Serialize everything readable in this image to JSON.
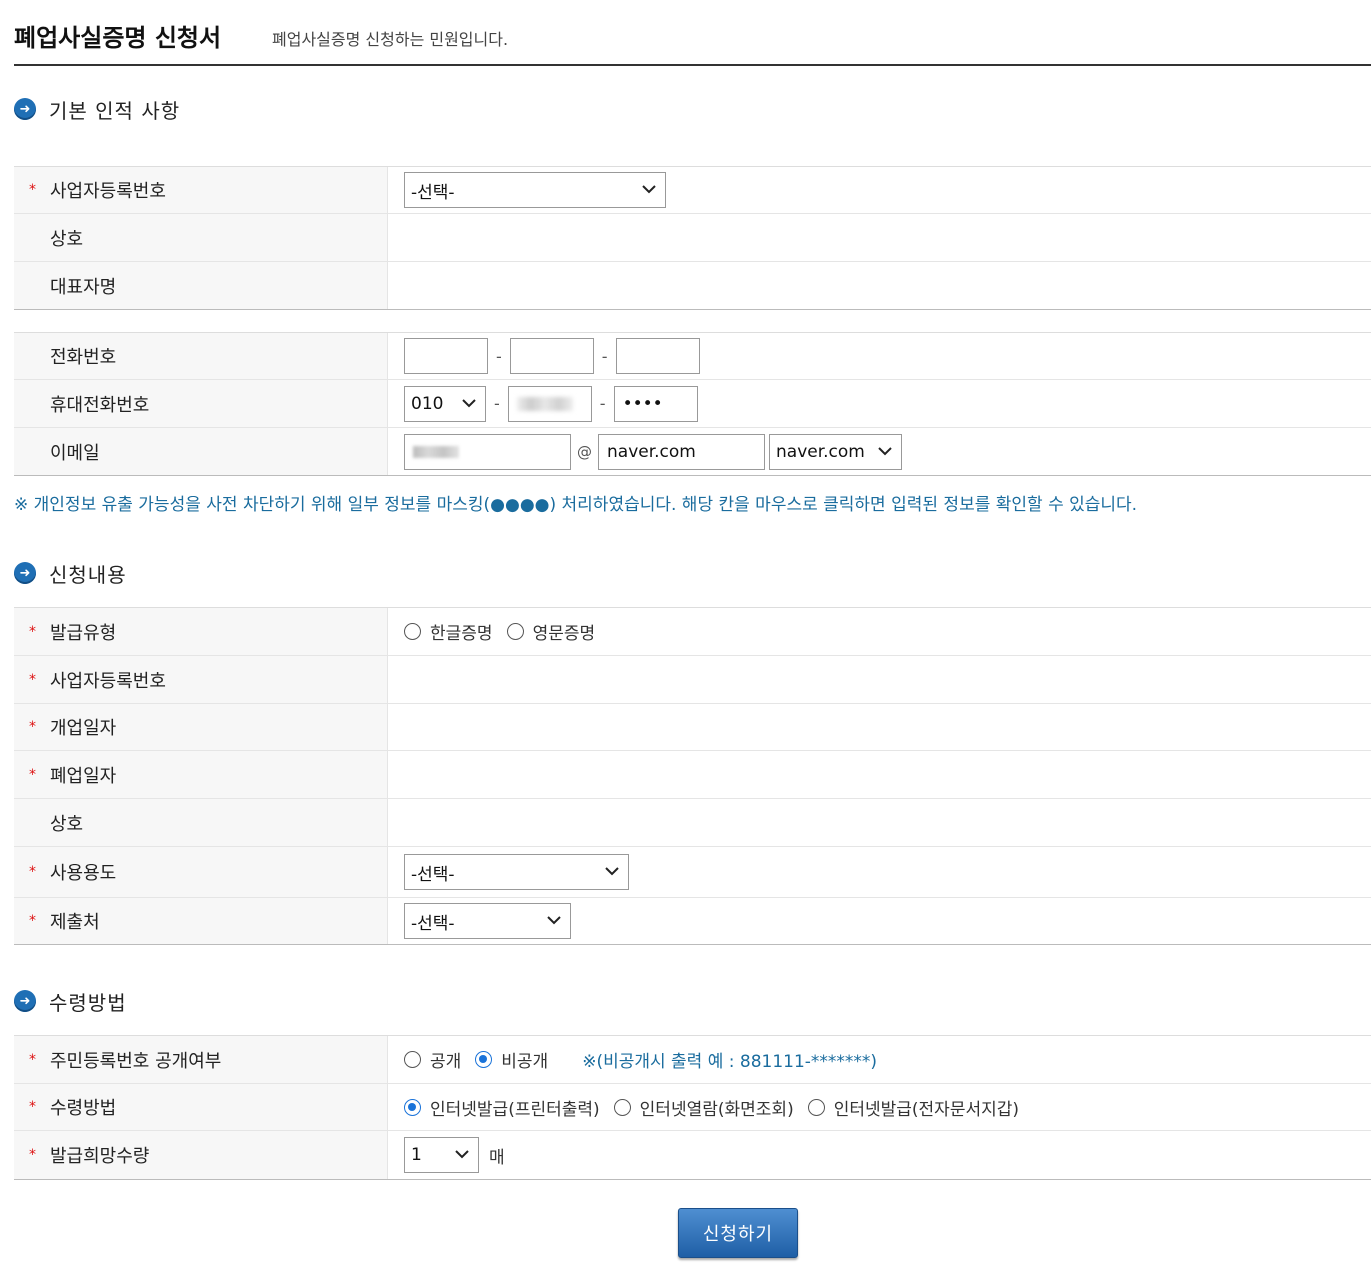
{
  "header": {
    "title": "폐업사실증명 신청서",
    "subtitle": "폐업사실증명 신청하는 민원입니다."
  },
  "required_mark": "*",
  "basic_info": {
    "section_title": "기본 인적 사항",
    "biz_reg_no": {
      "label": "사업자등록번호",
      "select_value": "-선택-"
    },
    "trade_name": {
      "label": "상호"
    },
    "representative": {
      "label": "대표자명"
    },
    "phone": {
      "label": "전화번호",
      "sep": "-"
    },
    "mobile": {
      "label": "휴대전화번호",
      "prefix": "010",
      "sep": "-",
      "last": "••••"
    },
    "email": {
      "label": "이메일",
      "at": "@",
      "domain_input": "naver.com",
      "domain_select": "naver.com"
    }
  },
  "notice": "※ 개인정보 유출 가능성을 사전 차단하기 위해 일부 정보를 마스킹(●●●●) 처리하였습니다. 해당 칸을 마우스로 클릭하면 입력된 정보를 확인할 수 있습니다.",
  "application": {
    "section_title": "신청내용",
    "issue_type": {
      "label": "발급유형",
      "options": [
        "한글증명",
        "영문증명"
      ]
    },
    "biz_reg_no": {
      "label": "사업자등록번호"
    },
    "open_date": {
      "label": "개업일자"
    },
    "close_date": {
      "label": "폐업일자"
    },
    "trade_name": {
      "label": "상호"
    },
    "purpose": {
      "label": "사용용도",
      "select_value": "-선택-"
    },
    "submit_to": {
      "label": "제출처",
      "select_value": "-선택-"
    }
  },
  "receipt": {
    "section_title": "수령방법",
    "rrn_disclosure": {
      "label": "주민등록번호 공개여부",
      "options": [
        "공개",
        "비공개"
      ],
      "selected": "비공개",
      "hint": "※(비공개시 출력 예 : 881111-*******)"
    },
    "method": {
      "label": "수령방법",
      "options": [
        "인터넷발급(프린터출력)",
        "인터넷열람(화면조회)",
        "인터넷발급(전자문서지갑)"
      ],
      "selected": "인터넷발급(프린터출력)"
    },
    "copies": {
      "label": "발급희망수량",
      "value": "1",
      "unit": "매"
    }
  },
  "submit_label": "신청하기",
  "colors": {
    "accent": "#1f6fb5",
    "notice": "#1a6c9e",
    "required": "#dd1111"
  },
  "icons": {
    "section": "arrow-right-circle-icon",
    "dropdown": "chevron-down-icon"
  }
}
